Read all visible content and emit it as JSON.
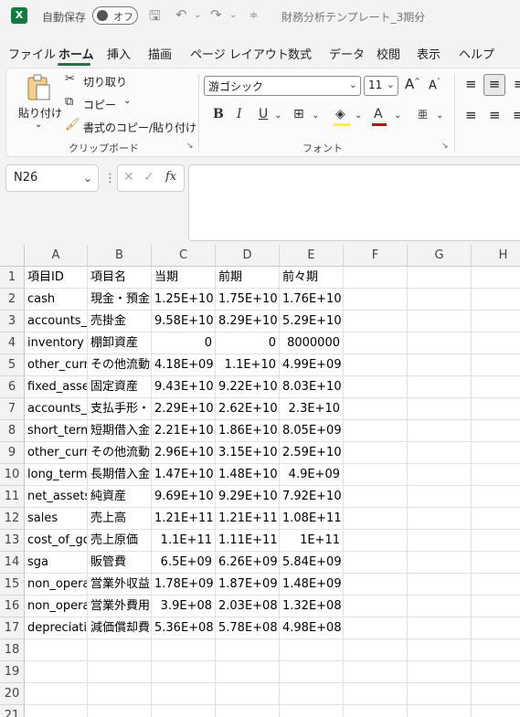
{
  "titlebar": {
    "autosave_label": "自動保存",
    "autosave_state": "オフ",
    "doc_title": "財務分析テンプレート_3期分"
  },
  "menu": [
    "ファイル",
    "ホーム",
    "挿入",
    "描画",
    "ページ レイアウト",
    "数式",
    "データ",
    "校閲",
    "表示",
    "ヘルプ"
  ],
  "ribbon": {
    "paste_label": "貼り付け",
    "cut_label": "切り取り",
    "copy_label": "コピー",
    "format_painter_label": "書式のコピー/貼り付け",
    "clipboard_group": "クリップボード",
    "font_name": "游ゴシック",
    "font_size": "11",
    "font_group": "フォント"
  },
  "formula_bar": {
    "name_box": "N26",
    "fx": "fx",
    "content": ""
  },
  "sheet": {
    "columns": [
      "A",
      "B",
      "C",
      "D",
      "E",
      "F",
      "G",
      "H"
    ],
    "row_numbers": [
      "1",
      "2",
      "3",
      "4",
      "5",
      "6",
      "7",
      "8",
      "9",
      "10",
      "11",
      "12",
      "13",
      "14",
      "15",
      "16",
      "17",
      "18",
      "19",
      "20",
      "21"
    ],
    "rows": [
      [
        "項目ID",
        "項目名",
        "当期",
        "前期",
        "前々期"
      ],
      [
        "cash",
        "現金・預金",
        "1.25E+10",
        "1.75E+10",
        "1.76E+10"
      ],
      [
        "accounts_receivable",
        "売掛金",
        "9.58E+10",
        "8.29E+10",
        "5.29E+10"
      ],
      [
        "inventory",
        "棚卸資産",
        "0",
        "0",
        "8000000"
      ],
      [
        "other_current_assets",
        "その他流動資産",
        "4.18E+09",
        "1.1E+10",
        "4.99E+09"
      ],
      [
        "fixed_assets",
        "固定資産",
        "9.43E+10",
        "9.22E+10",
        "8.03E+10"
      ],
      [
        "accounts_payable",
        "支払手形・買掛金",
        "2.29E+10",
        "2.62E+10",
        "2.3E+10"
      ],
      [
        "short_term_debt",
        "短期借入金",
        "2.21E+10",
        "1.86E+10",
        "8.05E+09"
      ],
      [
        "other_current_liabilities",
        "その他流動負債",
        "2.96E+10",
        "3.15E+10",
        "2.59E+10"
      ],
      [
        "long_term_debt",
        "長期借入金",
        "1.47E+10",
        "1.48E+10",
        "4.9E+09"
      ],
      [
        "net_assets",
        "純資産",
        "9.69E+10",
        "9.29E+10",
        "7.92E+10"
      ],
      [
        "sales",
        "売上高",
        "1.21E+11",
        "1.21E+11",
        "1.08E+11"
      ],
      [
        "cost_of_goods_sold",
        "売上原価",
        "1.1E+11",
        "1.11E+11",
        "1E+11"
      ],
      [
        "sga",
        "販管費",
        "6.5E+09",
        "6.26E+09",
        "5.84E+09"
      ],
      [
        "non_operating_income",
        "営業外収益",
        "1.78E+09",
        "1.87E+09",
        "1.48E+09"
      ],
      [
        "non_operating_expenses",
        "営業外費用",
        "3.9E+08",
        "2.03E+08",
        "1.32E+08"
      ],
      [
        "depreciation",
        "減価償却費",
        "5.36E+08",
        "5.78E+08",
        "4.98E+08"
      ]
    ]
  }
}
